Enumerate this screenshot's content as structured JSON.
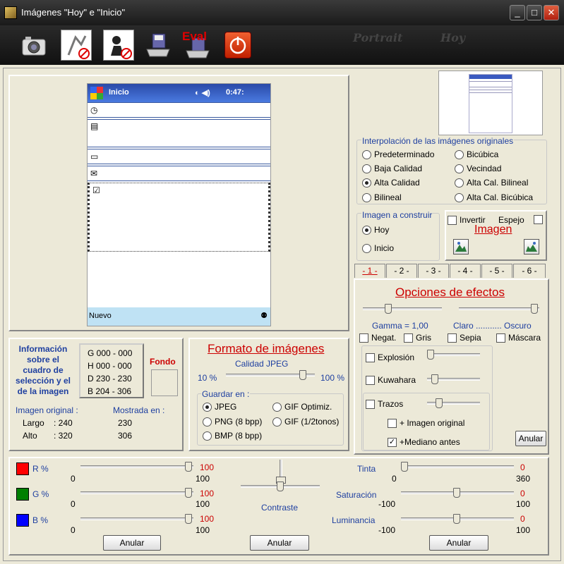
{
  "window": {
    "title": "Imágenes \"Hoy\" e \"Inicio\""
  },
  "toolbar": {
    "portrait": "Portrait",
    "hoy": "Hoy",
    "eval": "Eval"
  },
  "device": {
    "start": "Inicio",
    "time": "0:47:",
    "new": "Nuevo"
  },
  "info": {
    "title": "Información sobre el cuadro de selección y el de la imagen",
    "g": "G   000 - 000",
    "h": "H   000 - 000",
    "d": "D   230 - 230",
    "b": "B   204 - 306",
    "fondo": "Fondo",
    "original": "Imagen original :",
    "shown": "Mostrada en :",
    "largo": "Largo",
    "alto": "Alto",
    "largo_orig": ": 240",
    "alto_orig": ": 320",
    "largo_shown": "230",
    "alto_shown": "306"
  },
  "format": {
    "title": "Formato de imágenes",
    "quality": "Calidad JPEG",
    "q_min": "10 %",
    "q_max": "100 %",
    "quality_level": 0.9,
    "save_in": "Guardar en :",
    "options": [
      "JPEG",
      "GIF Optimiz.",
      "PNG (8 bpp)",
      "GIF (1/2tonos)",
      "BMP (8 bpp)"
    ]
  },
  "interp": {
    "title": "Interpolación de las imágenes originales",
    "options": [
      "Predeterminado",
      "Bicúbica",
      "Baja Calidad",
      "Vecindad",
      "Alta Calidad",
      "Alta Cal. Bilineal",
      "Bilineal",
      "Alta Cal. Bicúbica"
    ]
  },
  "build": {
    "title": "Imagen a construir",
    "hoy": "Hoy",
    "inicio": "Inicio"
  },
  "image": {
    "invert": "Invertir",
    "mirror": "Espejo",
    "title": "Imagen"
  },
  "tabs": [
    "- 1 -",
    "- 2 -",
    "- 3 -",
    "- 4 -",
    "- 5 -",
    "- 6 -"
  ],
  "effects": {
    "title": "Opciones de efectos",
    "gamma": "Gamma = 1,00",
    "claro": "Claro ........... Oscuro",
    "negat": "Negat.",
    "gris": "Gris",
    "sepia": "Sepia",
    "mascara": "Máscara",
    "explosion": "Explosión",
    "kuwahara": "Kuwahara",
    "trazos": "Trazos",
    "orig": "+ Imagen original",
    "mediano": "+Mediano antes",
    "anular": "Anular"
  },
  "colors": {
    "r": "R %",
    "g": "G %",
    "b": "B %",
    "val": "100",
    "min": "0",
    "max": "100",
    "contraste": "Contraste",
    "tinta": "Tinta",
    "tinta_val": "0",
    "tinta_min": "0",
    "tinta_max": "360",
    "sat": "Saturación",
    "sat_val": "0",
    "sat_min": "-100",
    "sat_max": "100",
    "lum": "Luminancia",
    "lum_val": "0",
    "lum_min": "-100",
    "lum_max": "100",
    "anular": "Anular",
    "red_hex": "#ff0000",
    "green_hex": "#008000",
    "blue_hex": "#0000ff"
  }
}
